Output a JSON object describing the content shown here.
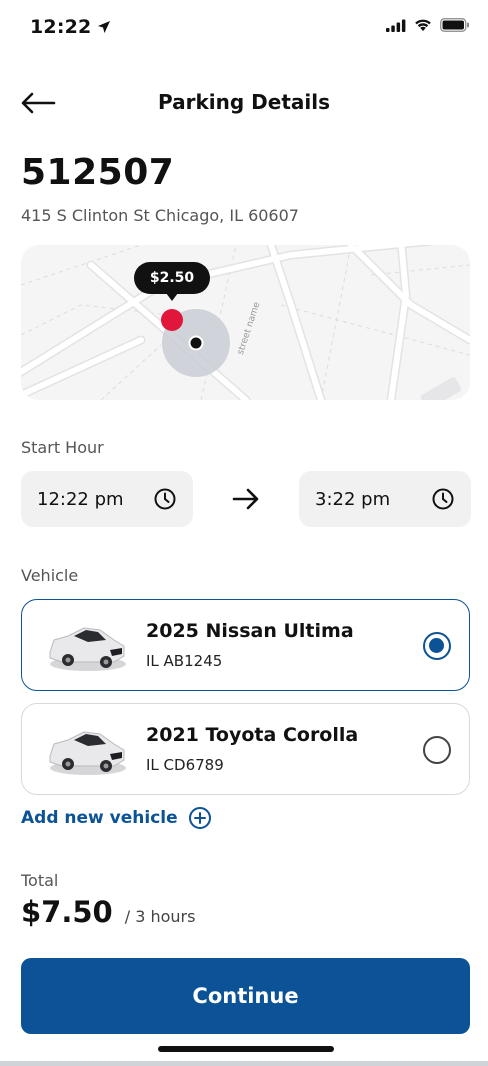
{
  "status_bar": {
    "time": "12:22",
    "icons": [
      "location-arrow-icon",
      "signal-icon",
      "wifi-icon",
      "battery-icon"
    ]
  },
  "header": {
    "title": "Parking Details",
    "back_icon": "arrow-left-icon"
  },
  "location": {
    "code": "512507",
    "address": "415 S Clinton St Chicago, IL 60607"
  },
  "map": {
    "price_label": "$2.50",
    "street_label": "street name"
  },
  "start_hour": {
    "label": "Start Hour",
    "start_time": "12:22 pm",
    "end_time": "3:22 pm",
    "clock_icon": "clock-icon",
    "arrow_icon": "arrow-right-icon"
  },
  "vehicle": {
    "label": "Vehicle",
    "items": [
      {
        "name": "2025 Nissan Ultima",
        "plate": "IL AB1245",
        "selected": true
      },
      {
        "name": "2021 Toyota Corolla",
        "plate": "IL CD6789",
        "selected": false
      }
    ],
    "add_label": "Add new vehicle",
    "add_icon": "plus-circle-icon"
  },
  "total": {
    "label": "Total",
    "amount": "$7.50",
    "duration": "/ 3 hours"
  },
  "actions": {
    "continue_label": "Continue"
  },
  "colors": {
    "primary": "#0b5396",
    "pin": "#e0173a",
    "text": "#111111",
    "muted": "#555555",
    "surface": "#f1f1f2"
  }
}
